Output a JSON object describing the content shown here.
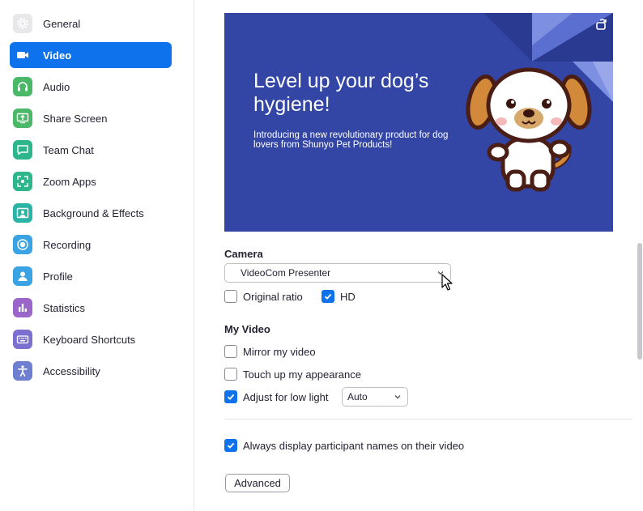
{
  "sidebar": {
    "items": [
      {
        "label": "General",
        "icon": "gear-icon",
        "color": "#e8e8ea"
      },
      {
        "label": "Video",
        "icon": "video-camera-icon",
        "color": "#0e72ed",
        "active": true
      },
      {
        "label": "Audio",
        "icon": "headphones-icon",
        "color": "#4ab866"
      },
      {
        "label": "Share Screen",
        "icon": "share-screen-icon",
        "color": "#4ab866"
      },
      {
        "label": "Team Chat",
        "icon": "chat-icon",
        "color": "#2db58b"
      },
      {
        "label": "Zoom Apps",
        "icon": "apps-icon",
        "color": "#2db58b"
      },
      {
        "label": "Background & Effects",
        "icon": "background-icon",
        "color": "#2bb3a6"
      },
      {
        "label": "Recording",
        "icon": "recording-icon",
        "color": "#3aa3e3"
      },
      {
        "label": "Profile",
        "icon": "profile-icon",
        "color": "#3aa3e3"
      },
      {
        "label": "Statistics",
        "icon": "statistics-icon",
        "color": "#9a66c9"
      },
      {
        "label": "Keyboard Shortcuts",
        "icon": "keyboard-icon",
        "color": "#7b6fd0"
      },
      {
        "label": "Accessibility",
        "icon": "accessibility-icon",
        "color": "#6e7fcf"
      }
    ]
  },
  "preview": {
    "title": "Level up your dog’s hygiene!",
    "subtitle": "Introducing a new revolutionary product for dog lovers from Shunyo Pet Products!",
    "background": "#3346a6"
  },
  "camera": {
    "label": "Camera",
    "selected": "VideoCom Presenter",
    "original_ratio": {
      "label": "Original ratio",
      "checked": false
    },
    "hd": {
      "label": "HD",
      "checked": true
    }
  },
  "my_video": {
    "label": "My Video",
    "mirror": {
      "label": "Mirror my video",
      "checked": false
    },
    "touch_up": {
      "label": "Touch up my appearance",
      "checked": false
    },
    "low_light": {
      "label": "Adjust for low light",
      "checked": true,
      "mode": "Auto"
    }
  },
  "participants": {
    "always_display_names": {
      "label": "Always display participant names on their video",
      "checked": true
    }
  },
  "advanced_button": "Advanced",
  "accent_color": "#0e72ed"
}
